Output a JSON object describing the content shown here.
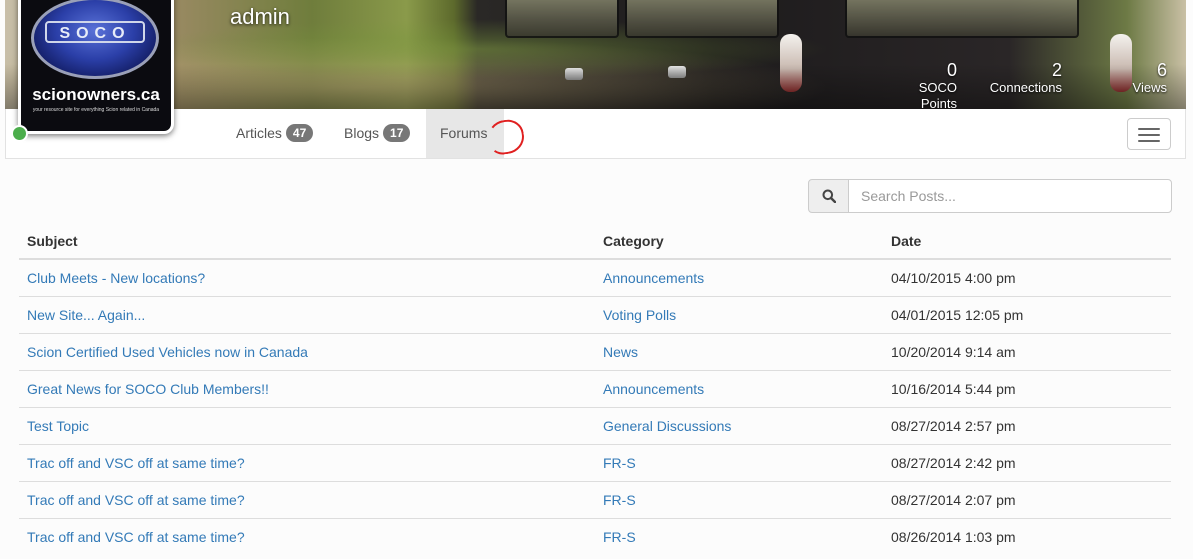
{
  "profile": {
    "username": "admin",
    "logo_site": "scionowners.ca",
    "logo_mark": "SOCO",
    "logo_tagline": "your resource site for everything Scion related in Canada",
    "online_status_color": "#4cae4c"
  },
  "stats": [
    {
      "value": "0",
      "label": "SOCO Points"
    },
    {
      "value": "2",
      "label": "Connections"
    },
    {
      "value": "6",
      "label": "Views"
    }
  ],
  "tabs": [
    {
      "label": "Articles",
      "count": "47",
      "active": false
    },
    {
      "label": "Blogs",
      "count": "17",
      "active": false
    },
    {
      "label": "Forums",
      "count": "",
      "active": true
    }
  ],
  "search": {
    "icon": "search-icon",
    "placeholder": "Search Posts..."
  },
  "table": {
    "headers": {
      "subject": "Subject",
      "category": "Category",
      "date": "Date"
    },
    "rows": [
      {
        "subject": "Club Meets - New locations?",
        "category": "Announcements",
        "date": "04/10/2015 4:00 pm"
      },
      {
        "subject": "New Site... Again...",
        "category": "Voting Polls",
        "date": "04/01/2015 12:05 pm"
      },
      {
        "subject": "Scion Certified Used Vehicles now in Canada",
        "category": "News",
        "date": "10/20/2014 9:14 am"
      },
      {
        "subject": "Great News for SOCO Club Members!!",
        "category": "Announcements",
        "date": "10/16/2014 5:44 pm"
      },
      {
        "subject": "Test Topic",
        "category": "General Discussions",
        "date": "08/27/2014 2:57 pm"
      },
      {
        "subject": "Trac off and VSC off at same time?",
        "category": "FR-S",
        "date": "08/27/2014 2:42 pm"
      },
      {
        "subject": "Trac off and VSC off at same time?",
        "category": "FR-S",
        "date": "08/27/2014 2:07 pm"
      },
      {
        "subject": "Trac off and VSC off at same time?",
        "category": "FR-S",
        "date": "08/26/2014 1:03 pm"
      }
    ]
  },
  "colors": {
    "link": "#337ab7",
    "badge": "#777777",
    "annotation": "#e02020"
  }
}
